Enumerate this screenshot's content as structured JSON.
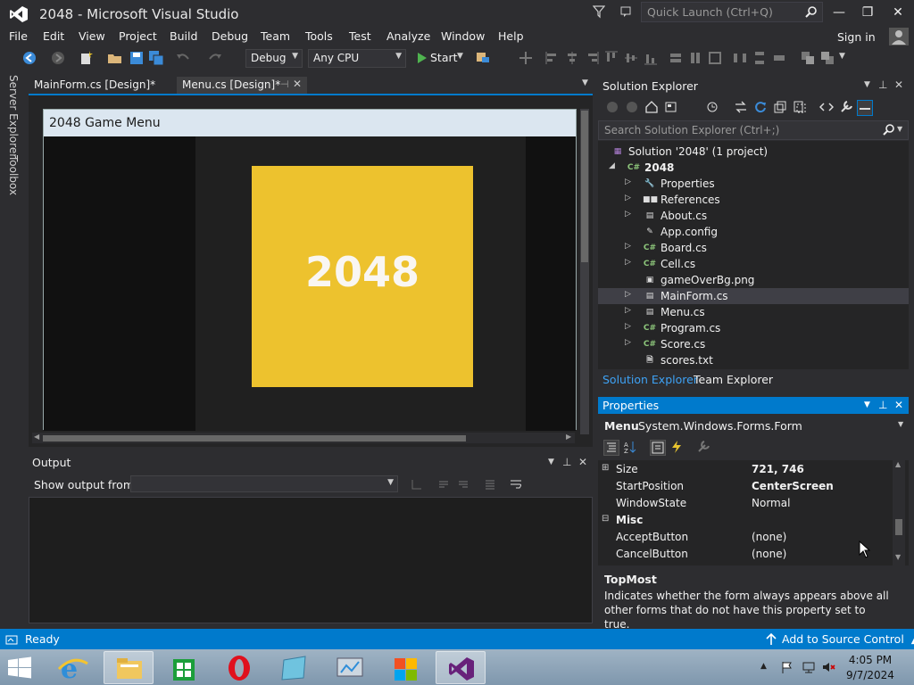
{
  "window": {
    "title": "2048 - Microsoft Visual Studio"
  },
  "quick_launch": {
    "placeholder": "Quick Launch (Ctrl+Q)"
  },
  "menu": [
    "File",
    "Edit",
    "View",
    "Project",
    "Build",
    "Debug",
    "Team",
    "Tools",
    "Test",
    "Analyze",
    "Window",
    "Help"
  ],
  "signin": "Sign in",
  "toolbar": {
    "config": "Debug",
    "platform": "Any CPU",
    "start": "Start"
  },
  "left_rail": {
    "server_explorer": "Server Explorer",
    "toolbox": "Toolbox"
  },
  "doc_tabs": [
    {
      "label": "MainForm.cs [Design]*",
      "active": false
    },
    {
      "label": "Menu.cs [Design]*",
      "active": true
    }
  ],
  "designer": {
    "form_caption": "2048 Game Menu",
    "tile_text": "2048",
    "tile_color": "#edc22e"
  },
  "output": {
    "title": "Output",
    "show_from_label": "Show output from:"
  },
  "solution_explorer": {
    "title": "Solution Explorer",
    "search_placeholder": "Search Solution Explorer (Ctrl+;)",
    "solution": "Solution '2048' (1 project)",
    "project": "2048",
    "items": [
      {
        "name": "Properties",
        "icon": "wrench-icon",
        "expandable": true
      },
      {
        "name": "References",
        "icon": "references-icon",
        "expandable": true
      },
      {
        "name": "About.cs",
        "icon": "form-icon",
        "expandable": true
      },
      {
        "name": "App.config",
        "icon": "config-icon",
        "expandable": false
      },
      {
        "name": "Board.cs",
        "icon": "csharp-icon",
        "expandable": true
      },
      {
        "name": "Cell.cs",
        "icon": "csharp-icon",
        "expandable": true
      },
      {
        "name": "gameOverBg.png",
        "icon": "image-icon",
        "expandable": false
      },
      {
        "name": "MainForm.cs",
        "icon": "form-icon",
        "expandable": true,
        "selected": true
      },
      {
        "name": "Menu.cs",
        "icon": "form-icon",
        "expandable": true
      },
      {
        "name": "Program.cs",
        "icon": "csharp-icon",
        "expandable": true
      },
      {
        "name": "Score.cs",
        "icon": "csharp-icon",
        "expandable": true
      },
      {
        "name": "scores.txt",
        "icon": "text-file-icon",
        "expandable": false
      }
    ],
    "tabs": [
      "Solution Explorer",
      "Team Explorer"
    ]
  },
  "properties": {
    "title": "Properties",
    "object_name": "Menu",
    "object_type": "System.Windows.Forms.Form",
    "rows": [
      {
        "name": "Size",
        "value": "721, 746",
        "bold": true,
        "expandable": true
      },
      {
        "name": "StartPosition",
        "value": "CenterScreen",
        "bold": true
      },
      {
        "name": "WindowState",
        "value": "Normal",
        "bold": false
      }
    ],
    "category": "Misc",
    "misc_rows": [
      {
        "name": "AcceptButton",
        "value": "(none)"
      },
      {
        "name": "CancelButton",
        "value": "(none)"
      }
    ],
    "desc_title": "TopMost",
    "desc_text": "Indicates whether the form always appears above all other forms that do not have this property set to true."
  },
  "status": {
    "text": "Ready",
    "right": "Add to Source Control"
  },
  "clock": {
    "time": "4:05 PM",
    "date": "9/7/2024"
  }
}
